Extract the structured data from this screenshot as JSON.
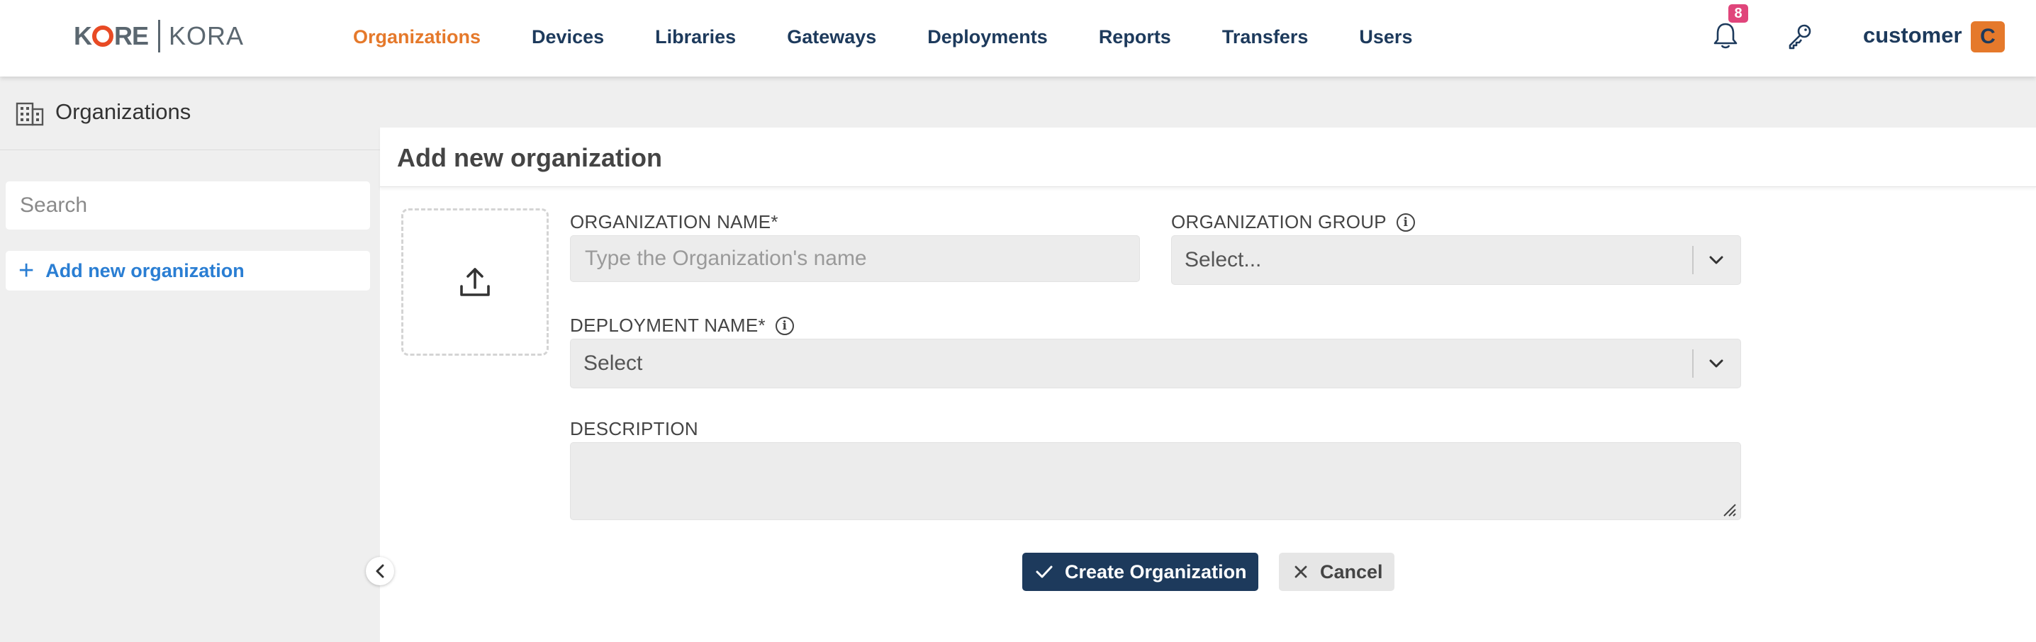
{
  "brand": {
    "part1": "K",
    "part1b": "RE",
    "part2": "KORA"
  },
  "nav": {
    "items": [
      {
        "label": "Organizations",
        "active": true
      },
      {
        "label": "Devices"
      },
      {
        "label": "Libraries"
      },
      {
        "label": "Gateways"
      },
      {
        "label": "Deployments"
      },
      {
        "label": "Reports"
      },
      {
        "label": "Transfers"
      },
      {
        "label": "Users"
      }
    ],
    "notifications_count": "8",
    "user_name": "customer",
    "user_initial": "C"
  },
  "sidebar": {
    "title": "Organizations",
    "search_placeholder": "Search",
    "add_label": "Add new organization"
  },
  "form": {
    "title": "Add new organization",
    "org_name_label": "ORGANIZATION NAME*",
    "org_name_placeholder": "Type the Organization's name",
    "org_group_label": "ORGANIZATION GROUP",
    "org_group_value": "Select...",
    "deployment_label": "DEPLOYMENT NAME*",
    "deployment_value": "Select",
    "description_label": "DESCRIPTION",
    "create_label": "Create Organization",
    "cancel_label": "Cancel"
  },
  "colors": {
    "accent": "#e5792b",
    "navy": "#1d3a5c",
    "link": "#2a7ed3",
    "badge": "#e0457b"
  }
}
